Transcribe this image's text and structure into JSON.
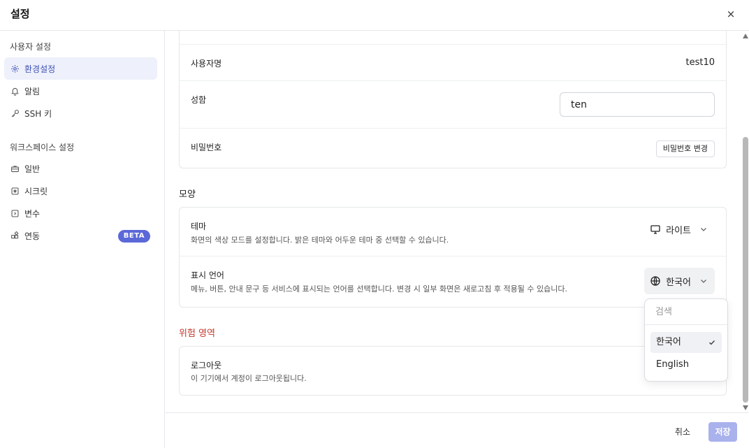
{
  "header": {
    "title": "설정",
    "close_label": "×"
  },
  "sidebar": {
    "user_group_label": "사용자 설정",
    "user_items": [
      {
        "label": "환경설정",
        "icon": "gear-icon",
        "active": true
      },
      {
        "label": "알림",
        "icon": "bell-icon"
      },
      {
        "label": "SSH 키",
        "icon": "key-icon"
      }
    ],
    "workspace_group_label": "워크스페이스 설정",
    "workspace_items": [
      {
        "label": "일반",
        "icon": "briefcase-icon"
      },
      {
        "label": "시크릿",
        "icon": "secret-icon"
      },
      {
        "label": "변수",
        "icon": "variable-icon"
      },
      {
        "label": "연동",
        "icon": "integration-icon",
        "badge": "BETA"
      }
    ]
  },
  "account": {
    "username_label": "사용자명",
    "username_value": "test10",
    "name_label": "성함",
    "name_value": "ten",
    "password_label": "비밀번호",
    "password_button": "비밀번호 변경"
  },
  "appearance": {
    "section_title": "모양",
    "theme_label": "테마",
    "theme_desc": "화면의 색상 모드를 설정합니다. 밝은 테마와 어두운 테마 중 선택할 수 있습니다.",
    "theme_value": "라이트",
    "language_label": "표시 언어",
    "language_desc": "메뉴, 버튼, 안내 문구 등 서비스에 표시되는 언어를 선택합니다. 변경 시 일부 화면은 새로고침 후 적용될 수 있습니다.",
    "language_value": "한국어"
  },
  "danger": {
    "section_title": "위험 영역",
    "logout_label": "로그아웃",
    "logout_desc": "이 기기에서 계정이 로그아웃됩니다."
  },
  "language_dropdown": {
    "search_placeholder": "검색",
    "options": [
      {
        "label": "한국어",
        "selected": true
      },
      {
        "label": "English",
        "selected": false
      }
    ]
  },
  "footer": {
    "cancel_label": "취소",
    "save_label": "저장"
  },
  "colors": {
    "accent": "#5b68d8",
    "danger": "#c0392b",
    "save_disabled": "#a9b2ec"
  }
}
